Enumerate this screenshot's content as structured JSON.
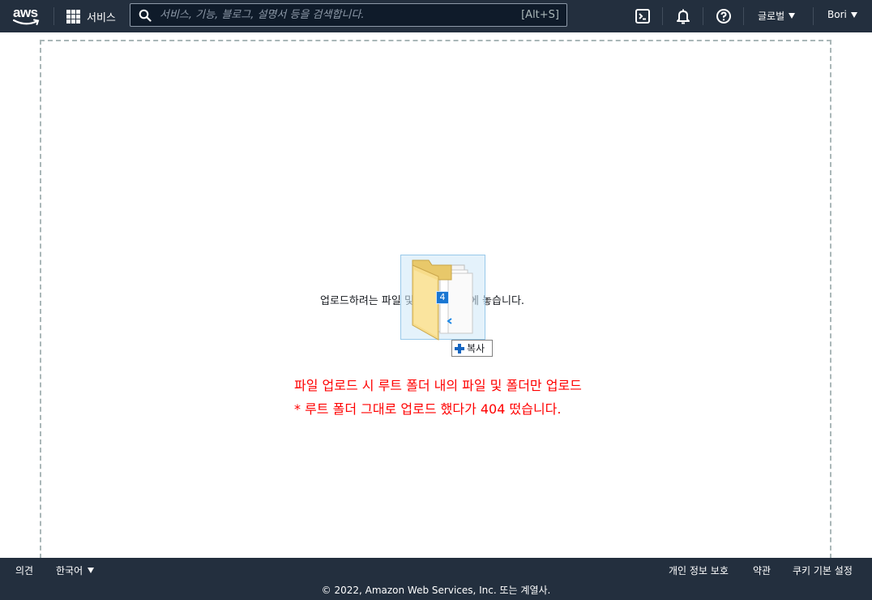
{
  "header": {
    "logo_text": "aws",
    "services_label": "서비스",
    "search": {
      "placeholder": "서비스, 기능, 블로그, 설명서 등을 검색합니다.",
      "shortcut": "[Alt+S]"
    },
    "icons": [
      "cloudshell-icon",
      "bell-icon",
      "help-icon"
    ],
    "region_label": "글로벌",
    "account_label": "Bori"
  },
  "main": {
    "drop_text": "업로드하려는 파일 및 폴더를 여기에 놓습니다.",
    "drag_count": "4",
    "drag_action": "복사",
    "notes": [
      "파일 업로드 시 루트 폴더 내의 파일 및 폴더만 업로드",
      "* 루트 폴더 그대로 업로드 했다가 404 떴습니다."
    ]
  },
  "footer": {
    "feedback": "의견",
    "language": "한국어",
    "privacy": "개인 정보 보호",
    "terms": "약관",
    "cookies": "쿠키 기본 설정",
    "copyright": "© 2022, Amazon Web Services, Inc. 또는 계열사."
  },
  "colors": {
    "nav_bg": "#232f3e",
    "note_text": "#ff0000",
    "dropzone_border": "#aab7b8",
    "smile": "#ff9900"
  }
}
